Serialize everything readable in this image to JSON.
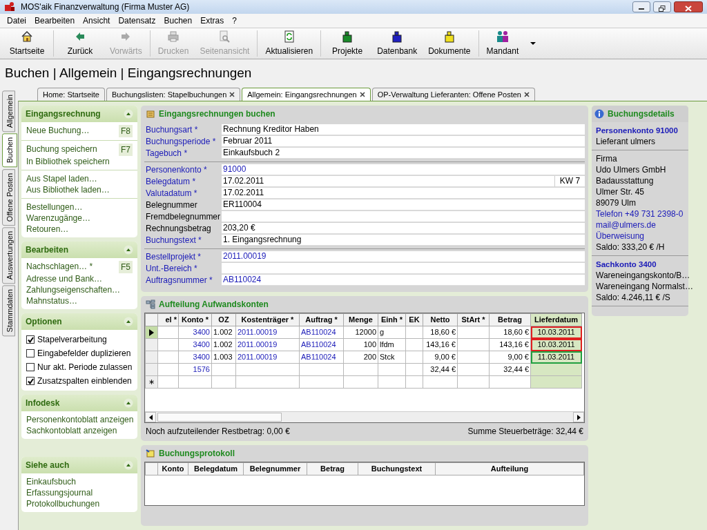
{
  "window": {
    "title": "MOS'aik Finanzverwaltung (Firma Muster AG)"
  },
  "menu": [
    "Datei",
    "Bearbeiten",
    "Ansicht",
    "Datensatz",
    "Buchen",
    "Extras",
    "?"
  ],
  "toolbar": [
    {
      "label": "Startseite",
      "disabled": false
    },
    {
      "label": "Zurück",
      "disabled": false
    },
    {
      "label": "Vorwärts",
      "disabled": true
    },
    {
      "label": "Drucken",
      "disabled": true
    },
    {
      "label": "Seitenansicht",
      "disabled": true
    },
    {
      "label": "Aktualisieren",
      "disabled": false
    },
    {
      "label": "Projekte",
      "disabled": false
    },
    {
      "label": "Datenbank",
      "disabled": false
    },
    {
      "label": "Dokumente",
      "disabled": false
    },
    {
      "label": "Mandant",
      "disabled": false
    }
  ],
  "page_title": "Buchen | Allgemein | Eingangsrechnungen",
  "side_tabs": [
    {
      "label": "Allgemein",
      "selected": false
    },
    {
      "label": "Buchen",
      "selected": true
    },
    {
      "label": "Offene Posten",
      "selected": false
    },
    {
      "label": "Auswertungen",
      "selected": false
    },
    {
      "label": "Stammdaten",
      "selected": false
    }
  ],
  "doc_tabs": [
    {
      "label": "Home: Startseite",
      "selected": false,
      "closable": false
    },
    {
      "label": "Buchungslisten: Stapelbuchungen",
      "selected": false,
      "closable": true
    },
    {
      "label": "Allgemein: Eingangsrechnungen",
      "selected": true,
      "closable": true
    },
    {
      "label": "OP-Verwaltung Lieferanten: Offene Posten",
      "selected": false,
      "closable": true
    }
  ],
  "sidebar": [
    {
      "title": "Eingangsrechnung",
      "groups": [
        [
          {
            "kind": "link",
            "label": "Neue Buchung…",
            "shortcut": "F8"
          }
        ],
        [
          {
            "kind": "link",
            "label": "Buchung speichern",
            "shortcut": "F7"
          },
          {
            "kind": "link",
            "label": "In Bibliothek speichern"
          }
        ],
        [
          {
            "kind": "link",
            "label": "Aus Stapel laden…"
          },
          {
            "kind": "link",
            "label": "Aus Bibliothek laden…"
          }
        ],
        [
          {
            "kind": "link",
            "label": "Bestellungen…"
          },
          {
            "kind": "link",
            "label": "Warenzugänge…"
          },
          {
            "kind": "link",
            "label": "Retouren…"
          }
        ]
      ]
    },
    {
      "title": "Bearbeiten",
      "groups": [
        [
          {
            "kind": "link",
            "label": "Nachschlagen… *",
            "shortcut": "F5"
          },
          {
            "kind": "link",
            "label": "Adresse und Bank…"
          },
          {
            "kind": "link",
            "label": "Zahlungseigenschaften…"
          },
          {
            "kind": "link",
            "label": "Mahnstatus…"
          }
        ]
      ]
    },
    {
      "title": "Optionen",
      "groups": [
        [
          {
            "kind": "checkbox",
            "label": "Stapelverarbeitung",
            "checked": true
          },
          {
            "kind": "checkbox",
            "label": "Eingabefelder duplizieren",
            "checked": false
          },
          {
            "kind": "checkbox",
            "label": "Nur akt. Periode zulassen",
            "checked": false
          },
          {
            "kind": "checkbox",
            "label": "Zusatzspalten einblenden",
            "checked": true
          }
        ]
      ]
    },
    {
      "title": "Infodesk",
      "groups": [
        [
          {
            "kind": "link",
            "label": "Personenkontoblatt anzeigen"
          },
          {
            "kind": "link",
            "label": "Sachkontoblatt anzeigen"
          }
        ]
      ]
    },
    {
      "title": "Siehe auch",
      "groups": [
        [
          {
            "kind": "link",
            "label": "Einkaufsbuch"
          },
          {
            "kind": "link",
            "label": "Erfassungsjournal"
          },
          {
            "kind": "link",
            "label": "Protokollbuchungen"
          }
        ]
      ]
    }
  ],
  "form": {
    "title": "Eingangsrechnungen buchen",
    "groups": [
      [
        {
          "label": "Buchungsart *",
          "required": true,
          "value": "Rechnung Kreditor Haben",
          "value_linked": false
        },
        {
          "label": "Buchungsperiode *",
          "required": true,
          "value": "Februar 2011",
          "value_linked": false
        },
        {
          "label": "Tagebuch *",
          "required": true,
          "value": "Einkaufsbuch 2",
          "value_linked": false
        }
      ],
      [
        {
          "label": "Personenkonto *",
          "required": true,
          "value": "91000",
          "value_linked": true
        },
        {
          "label": "Belegdatum *",
          "required": true,
          "value": "17.02.2011",
          "value_linked": false,
          "extra": "KW 7"
        },
        {
          "label": "Valutadatum *",
          "required": true,
          "value": "17.02.2011",
          "value_linked": false
        },
        {
          "label": "Belegnummer",
          "required": false,
          "value": "ER110004",
          "value_linked": false
        },
        {
          "label": "Fremdbelegnummer",
          "required": false
        },
        {
          "label": "Rechnungsbetrag",
          "required": false,
          "value": "203,20 €",
          "value_linked": false
        },
        {
          "label": "Buchungstext *",
          "required": true,
          "value": "1. Eingangsrechnung",
          "value_linked": false
        }
      ],
      [
        {
          "label": "Bestellprojekt *",
          "required": true,
          "value": "2011.00019",
          "value_linked": true
        },
        {
          "label": "Unt.-Bereich *",
          "required": true
        },
        {
          "label": "Auftragsnummer *",
          "required": true,
          "value": "AB110024",
          "value_linked": true
        }
      ]
    ]
  },
  "split": {
    "title": "Aufteilung Aufwandskonten",
    "columns": [
      {
        "label": "el *",
        "selected": false
      },
      {
        "label": "Konto *",
        "linked": true,
        "selected": false
      },
      {
        "label": "OZ",
        "linked": false,
        "selected": false
      },
      {
        "label": "Kostenträger *",
        "linked": true,
        "selected": false
      },
      {
        "label": "Auftrag *",
        "linked": true,
        "selected": false
      },
      {
        "label": "Menge",
        "linked": false,
        "selected": false
      },
      {
        "label": "Einh *",
        "linked": false,
        "selected": false
      },
      {
        "label": "EK",
        "selected": false
      },
      {
        "label": "Netto",
        "linked": false,
        "selected": false
      },
      {
        "label": "StArt *",
        "selected": false
      },
      {
        "label": "Betrag",
        "linked": false,
        "selected": false
      },
      {
        "label": "Lieferdatum",
        "linked": false,
        "selected": true
      }
    ],
    "rows": [
      {
        "current": true,
        "color": "#e02020",
        "cells": [
          "",
          "3400",
          "1.002",
          "2011.00019",
          "AB110024",
          "12000",
          "g",
          "",
          "18,60 €",
          "",
          "18,60 €",
          "10.03.2011"
        ]
      },
      {
        "current": false,
        "color": "#e02020",
        "cells": [
          "",
          "3400",
          "1.002",
          "2011.00019",
          "AB110024",
          "100",
          "lfdm",
          "",
          "143,16 €",
          "",
          "143,16 €",
          "10.03.2011"
        ]
      },
      {
        "current": false,
        "color": "#20a040",
        "cells": [
          "",
          "3400",
          "1.003",
          "2011.00019",
          "AB110024",
          "200",
          "Stck",
          "",
          "9,00 €",
          "",
          "9,00 €",
          "11.03.2011"
        ]
      },
      {
        "current": false,
        "cells": [
          "",
          "1576",
          "",
          "",
          "",
          "",
          "",
          "",
          "32,44 €",
          "",
          "32,44 €",
          ""
        ]
      }
    ],
    "new_row_marker": "∗",
    "footer_left": "Noch aufzuteilender Restbetrag: 0,00 €",
    "footer_right": "Summe Steuerbeträge: 32,44 €"
  },
  "details": {
    "title": "Buchungsdetails",
    "sections": [
      {
        "heading": "Personenkonto 91000",
        "lines": [
          {
            "text": "Lieferant ulmers",
            "linked": false
          }
        ]
      },
      {
        "lines": [
          {
            "text": "Firma",
            "linked": false
          },
          {
            "text": "Udo Ulmers GmbH",
            "linked": false
          },
          {
            "text": "Badausstattung",
            "linked": false
          },
          {
            "text": "Ulmer Str. 45",
            "linked": false
          },
          {
            "text": "89079 Ulm",
            "linked": false
          },
          {
            "text": "Telefon +49 731 2398-0",
            "linked": true
          },
          {
            "text": "mail@ulmers.de",
            "linked": true
          },
          {
            "text": "Überweisung",
            "linked": true
          },
          {
            "text": "Saldo: 333,20 € /H",
            "linked": false
          }
        ]
      },
      {
        "heading": "Sachkonto 3400",
        "lines": [
          {
            "text": "Wareneingangskonto/B…",
            "linked": false
          },
          {
            "text": "Wareneingang Normalst…",
            "linked": false
          },
          {
            "text": "Saldo: 4.246,11 € /S",
            "linked": false
          }
        ]
      }
    ]
  },
  "protocol": {
    "title": "Buchungsprotokoll",
    "columns": [
      "Konto",
      "Belegdatum",
      "Belegnummer",
      "Betrag",
      "Buchungstext",
      "Aufteilung"
    ]
  }
}
